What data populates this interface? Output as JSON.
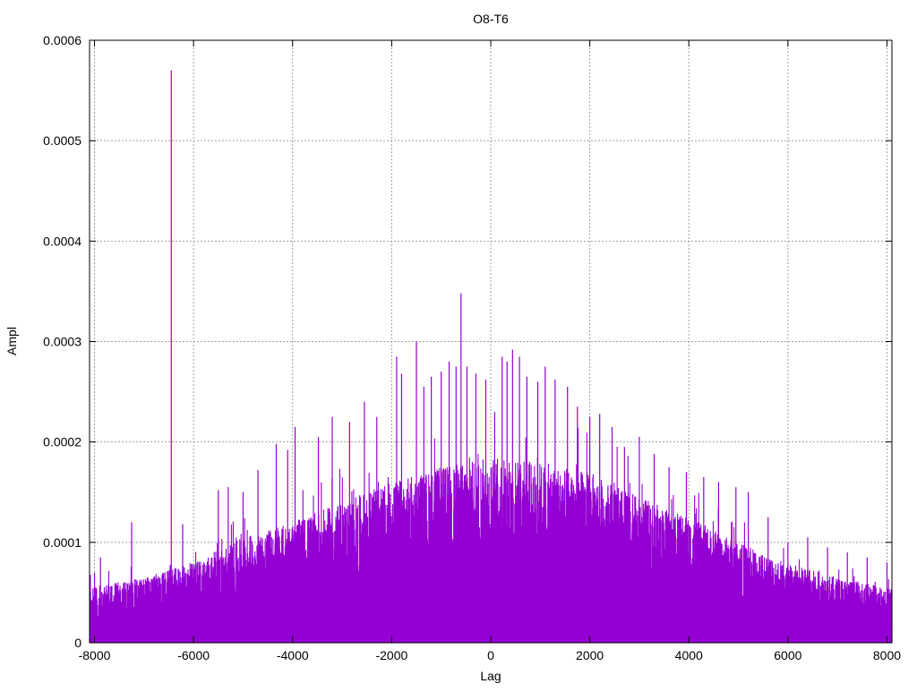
{
  "chart_data": {
    "type": "bar",
    "style": "impulses",
    "title": "O8-T6",
    "xlabel": "Lag",
    "ylabel": "Ampl",
    "xlim": [
      -8100,
      8100
    ],
    "ylim": [
      0,
      0.0006
    ],
    "x_ticks": [
      -8000,
      -6000,
      -4000,
      -2000,
      0,
      2000,
      4000,
      6000,
      8000
    ],
    "x_tick_labels": [
      "-8000",
      "-6000",
      "-4000",
      "-2000",
      "0",
      "2000",
      "4000",
      "6000",
      "8000"
    ],
    "y_ticks": [
      0,
      0.0001,
      0.0002,
      0.0003,
      0.0004,
      0.0005,
      0.0006
    ],
    "y_tick_labels": [
      "0",
      "0.0001",
      "0.0002",
      "0.0003",
      "0.0004",
      "0.0005",
      "0.0006"
    ],
    "grid": true,
    "legend": "none",
    "series_color": "#9400d3",
    "series": [
      {
        "name": "",
        "envelope_x": [
          -8100,
          -7000,
          -6000,
          -5000,
          -4000,
          -3000,
          -2000,
          -1000,
          0,
          1000,
          2000,
          3000,
          4000,
          5000,
          6000,
          7000,
          8100
        ],
        "envelope_ampl": [
          5.5e-05,
          6.5e-05,
          8e-05,
          0.000105,
          0.00012,
          0.00014,
          0.00016,
          0.000175,
          0.000185,
          0.00018,
          0.00017,
          0.000145,
          0.000125,
          0.0001,
          8e-05,
          6.5e-05,
          5.5e-05
        ],
        "peaks": [
          {
            "x": -8000,
            "y": 7e-05
          },
          {
            "x": -7880,
            "y": 8.5e-05
          },
          {
            "x": -7250,
            "y": 0.00012
          },
          {
            "x": -6450,
            "y": 0.00057
          },
          {
            "x": -6220,
            "y": 0.000118
          },
          {
            "x": -5500,
            "y": 0.000152
          },
          {
            "x": -5300,
            "y": 0.000155
          },
          {
            "x": -5000,
            "y": 0.00015
          },
          {
            "x": -4700,
            "y": 0.000172
          },
          {
            "x": -4330,
            "y": 0.000198
          },
          {
            "x": -4100,
            "y": 0.000192
          },
          {
            "x": -3950,
            "y": 0.000215
          },
          {
            "x": -3480,
            "y": 0.000205
          },
          {
            "x": -3200,
            "y": 0.000225
          },
          {
            "x": -2850,
            "y": 0.00022
          },
          {
            "x": -2550,
            "y": 0.00024
          },
          {
            "x": -2300,
            "y": 0.000225
          },
          {
            "x": -1900,
            "y": 0.000285
          },
          {
            "x": -1800,
            "y": 0.000268
          },
          {
            "x": -1500,
            "y": 0.0003
          },
          {
            "x": -1350,
            "y": 0.000255
          },
          {
            "x": -1200,
            "y": 0.000265
          },
          {
            "x": -1000,
            "y": 0.00027
          },
          {
            "x": -840,
            "y": 0.00028
          },
          {
            "x": -700,
            "y": 0.000275
          },
          {
            "x": -600,
            "y": 0.000348
          },
          {
            "x": -480,
            "y": 0.000275
          },
          {
            "x": -300,
            "y": 0.000268
          },
          {
            "x": -100,
            "y": 0.000262
          },
          {
            "x": 80,
            "y": 0.00023
          },
          {
            "x": 230,
            "y": 0.000285
          },
          {
            "x": 330,
            "y": 0.00028
          },
          {
            "x": 440,
            "y": 0.000292
          },
          {
            "x": 580,
            "y": 0.000285
          },
          {
            "x": 730,
            "y": 0.000265
          },
          {
            "x": 950,
            "y": 0.00026
          },
          {
            "x": 1100,
            "y": 0.000275
          },
          {
            "x": 1300,
            "y": 0.000262
          },
          {
            "x": 1550,
            "y": 0.000255
          },
          {
            "x": 1750,
            "y": 0.000235
          },
          {
            "x": 2000,
            "y": 0.000225
          },
          {
            "x": 2200,
            "y": 0.000228
          },
          {
            "x": 2450,
            "y": 0.000215
          },
          {
            "x": 2700,
            "y": 0.000195
          },
          {
            "x": 3000,
            "y": 0.000205
          },
          {
            "x": 3300,
            "y": 0.000188
          },
          {
            "x": 3600,
            "y": 0.000175
          },
          {
            "x": 3950,
            "y": 0.00017
          },
          {
            "x": 4300,
            "y": 0.000165
          },
          {
            "x": 4600,
            "y": 0.00016
          },
          {
            "x": 4950,
            "y": 0.000155
          },
          {
            "x": 5200,
            "y": 0.00015
          },
          {
            "x": 5600,
            "y": 0.000125
          },
          {
            "x": 6000,
            "y": 0.0001
          },
          {
            "x": 6400,
            "y": 0.000105
          },
          {
            "x": 6800,
            "y": 9.5e-05
          },
          {
            "x": 7200,
            "y": 9e-05
          },
          {
            "x": 7600,
            "y": 8.5e-05
          },
          {
            "x": 8000,
            "y": 8e-05
          }
        ]
      }
    ]
  }
}
